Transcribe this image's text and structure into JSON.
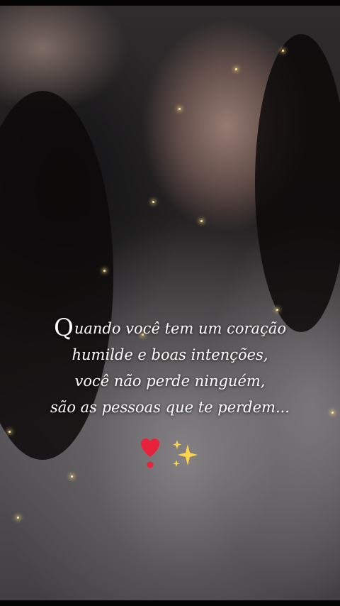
{
  "quote": {
    "dropcap": "Q",
    "line1_rest": "uando você tem um coração",
    "line2": "humilde e boas intenções,",
    "line3": "você não perde ninguém,",
    "line4": "são as pessoas que te perdem..."
  },
  "decorations": {
    "heart_icon": "heart-exclamation-icon",
    "sparkles_icon": "sparkles-icon",
    "heart_color": "#e8223a",
    "sparkle_color": "#ffd54a"
  }
}
